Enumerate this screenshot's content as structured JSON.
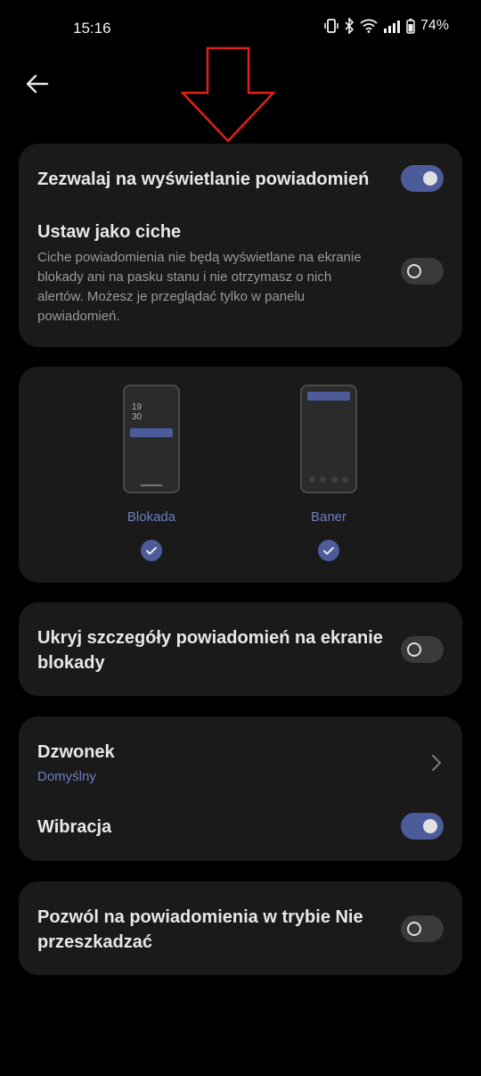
{
  "status_bar": {
    "time": "15:16",
    "battery": "74%"
  },
  "annotation": {
    "arrow_color": "#e0201b"
  },
  "colors": {
    "accent": "#4c5c9a",
    "link": "#6f7fbf"
  },
  "card1": {
    "allow_title": "Zezwalaj na wyświetlanie powiadomień",
    "allow_on": true,
    "silent_title": "Ustaw jako ciche",
    "silent_desc": "Ciche powiadomienia nie będą wyświetlane na ekranie blokady ani na pasku stanu i nie otrzymasz o nich alertów. Możesz je przeglądać tylko w panelu powiadomień.",
    "silent_on": false
  },
  "card2": {
    "lock_preview_hour": "19",
    "lock_preview_min": "30",
    "lock_label": "Blokada",
    "banner_label": "Baner",
    "lock_checked": true,
    "banner_checked": true
  },
  "card3": {
    "hide_title": "Ukryj szczegóły powiadomień na ekranie blokady",
    "hide_on": false
  },
  "card4": {
    "ringtone_title": "Dzwonek",
    "ringtone_value": "Domyślny",
    "vibration_title": "Wibracja",
    "vibration_on": true
  },
  "card5": {
    "dnd_title": "Pozwól na powiadomienia w trybie Nie przeszkadzać",
    "dnd_on": false
  }
}
